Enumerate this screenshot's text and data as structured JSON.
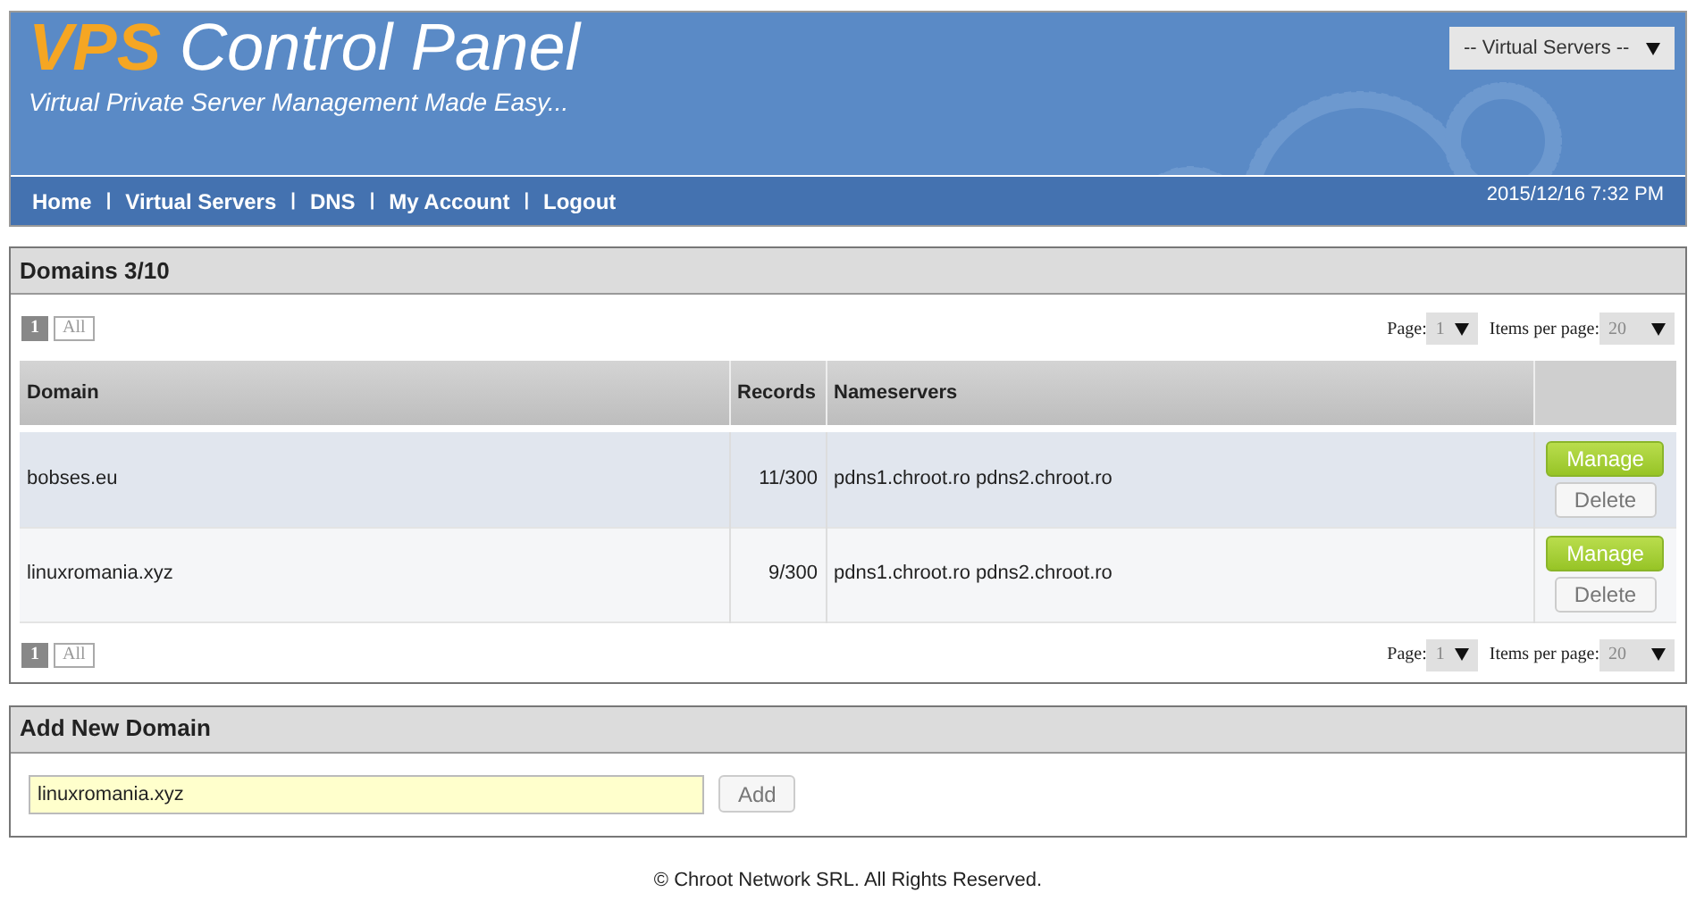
{
  "header": {
    "title_accent": "VPS",
    "title": "Control Panel",
    "subtitle": "Virtual Private Server Management Made Easy...",
    "server_select": "-- Virtual Servers --"
  },
  "nav": {
    "items": [
      "Home",
      "Virtual Servers",
      "DNS",
      "My Account",
      "Logout"
    ],
    "separator": "|",
    "datetime": "2015/12/16 7:32 PM"
  },
  "domains": {
    "title": "Domains 3/10",
    "pagers": [
      {
        "links": [
          {
            "label": "1",
            "selected": true
          },
          {
            "label": "All",
            "selected": false
          }
        ],
        "page_label": "Page:",
        "page_value": "1",
        "per_page_label": "Items per page:",
        "per_page_value": "20"
      },
      {
        "links": [
          {
            "label": "1",
            "selected": true
          },
          {
            "label": "All",
            "selected": false
          }
        ],
        "page_label": "Page:",
        "page_value": "1",
        "per_page_label": "Items per page:",
        "per_page_value": "20"
      }
    ],
    "columns": [
      "Domain",
      "Records",
      "Nameservers"
    ],
    "rows": [
      {
        "domain": "bobses.eu",
        "records": "11/300",
        "nameservers": "pdns1.chroot.ro pdns2.chroot.ro",
        "manage": "Manage",
        "delete": "Delete"
      },
      {
        "domain": "linuxromania.xyz",
        "records": "9/300",
        "nameservers": "pdns1.chroot.ro pdns2.chroot.ro",
        "manage": "Manage",
        "delete": "Delete"
      }
    ]
  },
  "add_domain": {
    "title": "Add New Domain",
    "value": "linuxromania.xyz",
    "button": "Add"
  },
  "footer": "© Chroot Network SRL. All Rights Reserved."
}
